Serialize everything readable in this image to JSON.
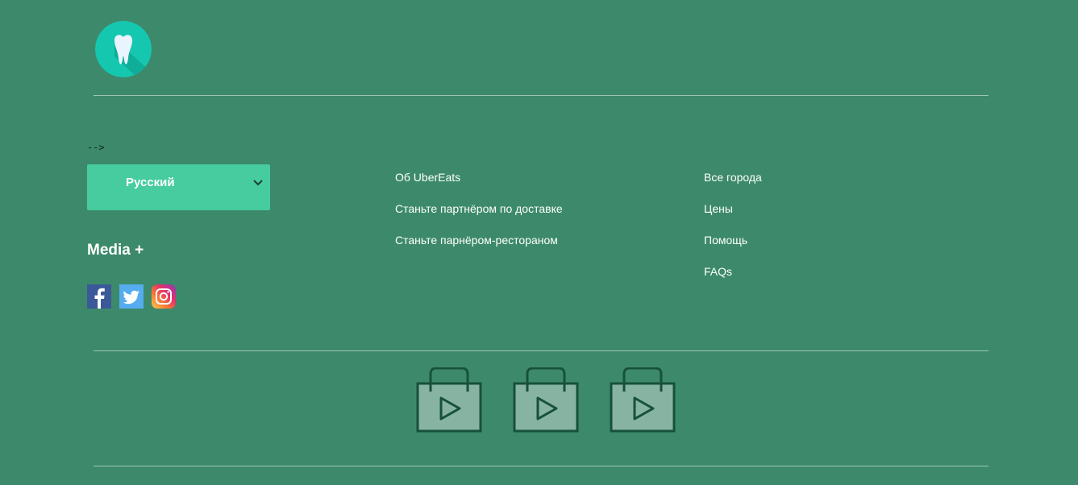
{
  "header": {
    "logo_icon": "tooth-icon",
    "logo_colors": {
      "circle": "#16c7b0",
      "shadow": "#0ea894",
      "tooth": "#e9f4ff"
    }
  },
  "stray_text": "-->",
  "language_select": {
    "selected": "Русский",
    "icon": "chevron-down-icon",
    "background": "#46cc9f"
  },
  "media": {
    "title": "Media +",
    "social": [
      {
        "name": "facebook-icon",
        "color": "#3b5998"
      },
      {
        "name": "twitter-icon",
        "color": "#55acee"
      },
      {
        "name": "instagram-icon",
        "color": "#e1306c"
      }
    ]
  },
  "links": {
    "column1": [
      "Об UberEats",
      "Станьте партнёром по доставке",
      "Станьте парнёром-рестораном"
    ],
    "column2": [
      "Все города",
      "Цены",
      "Помощь",
      "FAQs"
    ]
  },
  "app_stores": {
    "icon": "store-bag-play-icon",
    "count": 3,
    "colors": {
      "fill": "#87b3a2",
      "stroke": "#17513a"
    }
  },
  "theme": {
    "background": "#3c8a6b",
    "divider": "#9fc6b5",
    "text": "#ffffff"
  }
}
